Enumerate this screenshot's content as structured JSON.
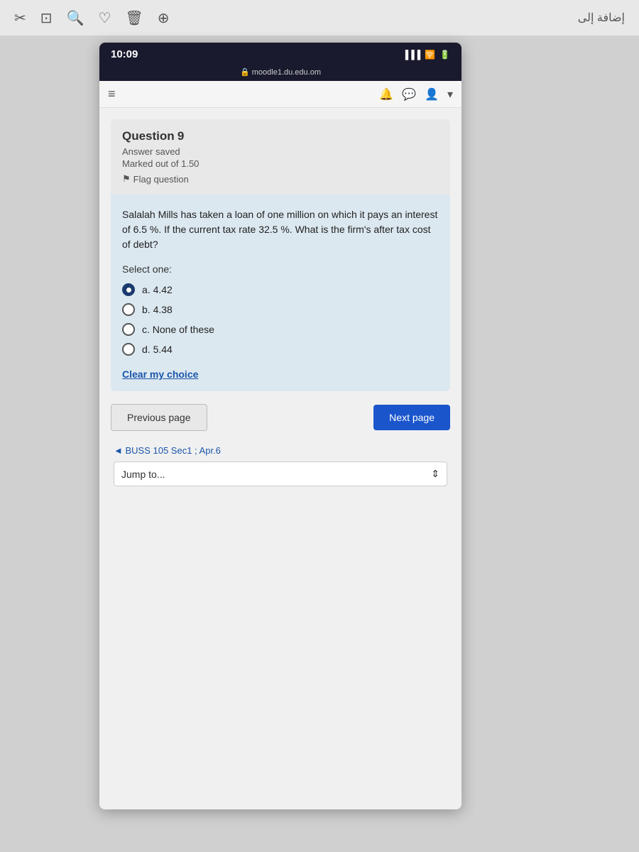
{
  "desktop": {
    "top_bar_icons_left": [
      "crop-icon",
      "rotate-icon",
      "heart-icon",
      "trash-icon",
      "zoom-icon"
    ],
    "top_bar_text_right": "إضافة إلى"
  },
  "phone": {
    "status_bar": {
      "time": "10:09",
      "signal": "●●●",
      "wifi": "WiFi",
      "battery": "🔋"
    },
    "url": "moodle1.du.edu.om"
  },
  "question": {
    "number_label": "Question",
    "number": "9",
    "answer_status": "Answer saved",
    "marked_label": "Marked out of 1.50",
    "flag_label": "Flag question",
    "body_text": "Salalah Mills has taken a loan of one million on which it pays an interest of 6.5 %. If the current tax rate 32.5 %. What is the firm's after tax cost of debt?",
    "select_one_label": "Select one:",
    "options": [
      {
        "id": "a",
        "label": "a. 4.42",
        "selected": true
      },
      {
        "id": "b",
        "label": "b. 4.38",
        "selected": false
      },
      {
        "id": "c",
        "label": "c. None of these",
        "selected": false
      },
      {
        "id": "d",
        "label": "d. 5.44",
        "selected": false
      }
    ],
    "clear_choice_label": "Clear my choice"
  },
  "navigation": {
    "previous_label": "Previous page",
    "next_label": "Next page"
  },
  "footer": {
    "back_link": "◄ BUSS 105 Sec1 ; Apr.6",
    "jump_label": "Jump to..."
  }
}
